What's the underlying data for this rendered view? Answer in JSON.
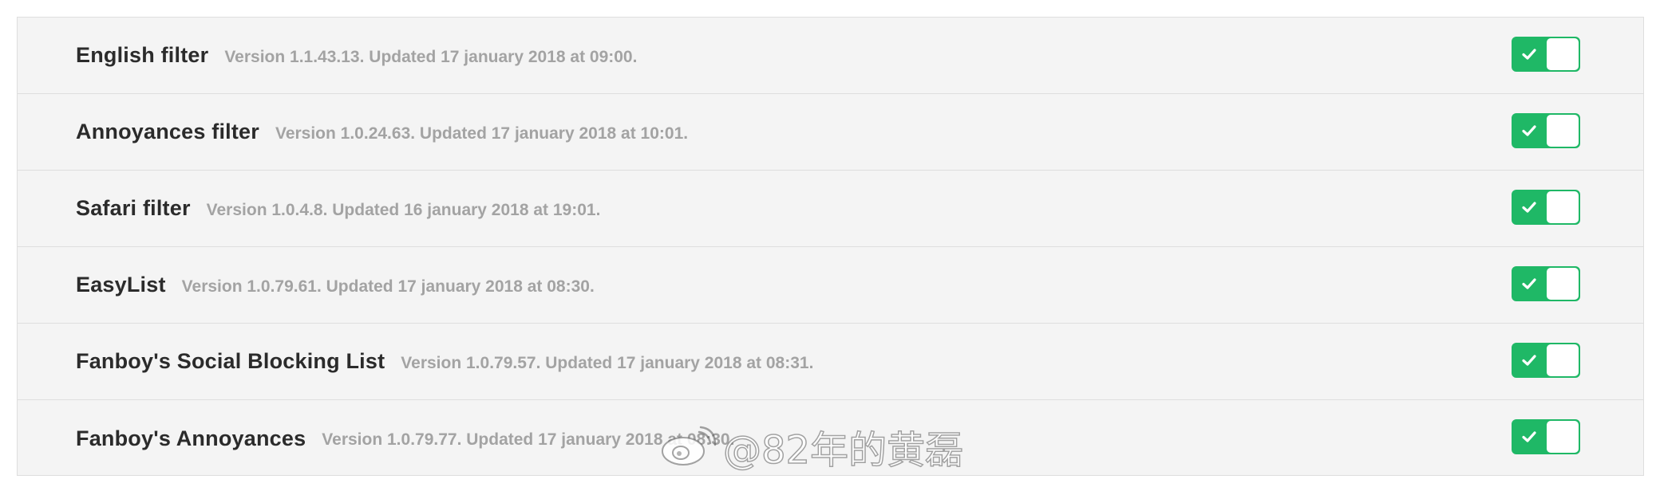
{
  "filters": [
    {
      "name": "English filter",
      "meta": "Version 1.1.43.13. Updated 17 january 2018 at 09:00.",
      "enabled": true
    },
    {
      "name": "Annoyances filter",
      "meta": "Version 1.0.24.63. Updated 17 january 2018 at 10:01.",
      "enabled": true
    },
    {
      "name": "Safari filter",
      "meta": "Version 1.0.4.8. Updated 16 january 2018 at 19:01.",
      "enabled": true
    },
    {
      "name": "EasyList",
      "meta": "Version 1.0.79.61. Updated 17 january 2018 at 08:30.",
      "enabled": true
    },
    {
      "name": "Fanboy's Social Blocking List",
      "meta": "Version 1.0.79.57. Updated 17 january 2018 at 08:31.",
      "enabled": true
    },
    {
      "name": "Fanboy's Annoyances",
      "meta": "Version 1.0.79.77. Updated 17 january 2018 at 08:30.",
      "enabled": true
    }
  ],
  "toggle": {
    "on_color": "#1fb866",
    "icon": "check-icon"
  },
  "watermark": {
    "text": "@82年的黄磊",
    "icon": "weibo-logo-icon"
  }
}
